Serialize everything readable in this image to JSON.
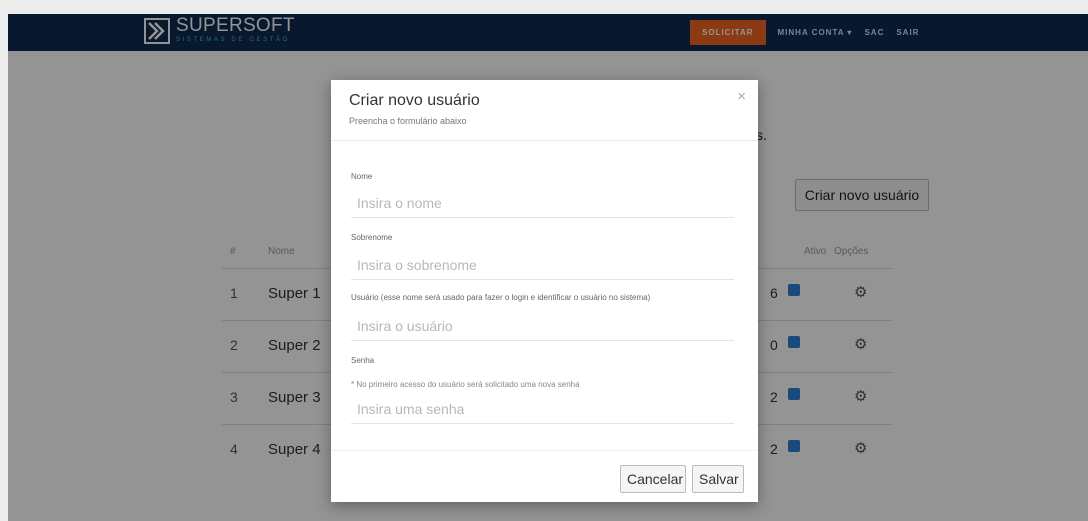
{
  "brand": {
    "title": "SUPERSOFT",
    "subtitle": "Sistemas de Gestão"
  },
  "nav": {
    "cta": "SOLICITAR",
    "account": "MINHA CONTA ▾",
    "support": "SAC",
    "logout": "SAIR"
  },
  "page": {
    "text_fragment": "s.",
    "create_user_button": "Criar novo usuário",
    "table": {
      "headers": [
        "#",
        "Nome",
        "",
        "Ativo",
        "Opções"
      ],
      "rows": [
        {
          "idx": "1",
          "name": "Super 1",
          "num": "6"
        },
        {
          "idx": "2",
          "name": "Super 2",
          "num": "0"
        },
        {
          "idx": "3",
          "name": "Super 3",
          "num": "2"
        },
        {
          "idx": "4",
          "name": "Super 4",
          "num": "2"
        }
      ]
    }
  },
  "modal": {
    "title": "Criar novo usuário",
    "subtitle": "Preencha o formulário abaixo",
    "close": "×",
    "fields": {
      "nome": {
        "label": "Nome",
        "placeholder": "Insira o nome"
      },
      "sobrenome": {
        "label": "Sobrenome",
        "placeholder": "Insira o sobrenome"
      },
      "usuario": {
        "label": "Usuário (esse nome será usado para fazer o login e identificar o usuário no sistema)",
        "placeholder": "Insira o usuário"
      },
      "senha": {
        "label": "Senha",
        "hint": "* No primeiro acesso do usuário será solicitado uma nova senha",
        "placeholder": "Insira uma senha"
      }
    },
    "buttons": {
      "cancel": "Cancelar",
      "save": "Salvar"
    }
  },
  "colors": {
    "navbar": "#0e2a52",
    "cta": "#f26522",
    "accent": "#4fb3e6",
    "checkbox": "#2d7fd9"
  },
  "icons": {
    "logo": "supersoft-logo-icon",
    "gear": "gear-icon",
    "close": "close-icon"
  }
}
